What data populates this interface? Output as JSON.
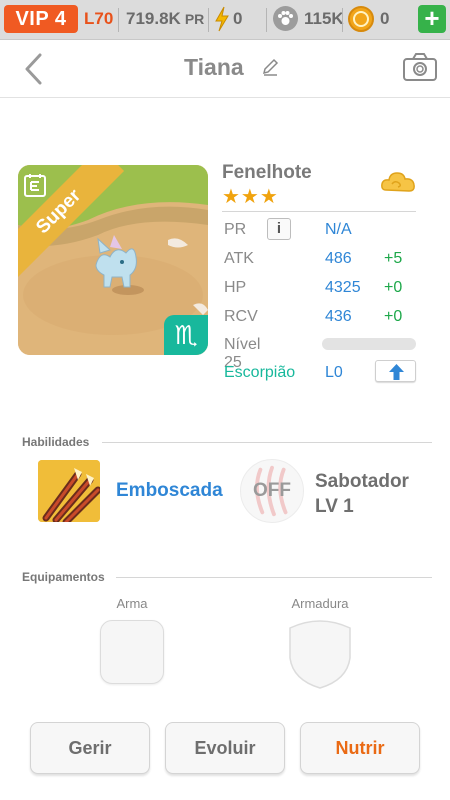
{
  "topbar": {
    "vip": "VIP 4",
    "level": "L70",
    "power": "719.8K",
    "power_unit": "PR",
    "energy": "0",
    "paw": "115K",
    "coins": "0",
    "add": "+"
  },
  "header": {
    "title": "Tiana"
  },
  "pet": {
    "badge": "Super",
    "name": "Fenelhote",
    "stars": "★★★",
    "zodiac_symbol": "♏",
    "stats": [
      {
        "label": "PR",
        "value": "N/A",
        "bonus": ""
      },
      {
        "label": "ATK",
        "value": "486",
        "bonus": "+5"
      },
      {
        "label": "HP",
        "value": "4325",
        "bonus": "+0"
      },
      {
        "label": "RCV",
        "value": "436",
        "bonus": "+0"
      }
    ],
    "info": "i",
    "level_label": "Nível 25",
    "level_progress": 0.0,
    "zodiac_name": "Escorpião",
    "zodiac_level": "L0"
  },
  "skills": {
    "title": "Habilidades",
    "active_name": "Emboscada",
    "passive_state": "OFF",
    "passive_name_line1": "Sabotador",
    "passive_name_line2": "LV 1"
  },
  "equipment": {
    "title": "Equipamentos",
    "weapon_label": "Arma",
    "armor_label": "Armadura"
  },
  "buttons": {
    "manage": "Gerir",
    "evolve": "Evoluir",
    "feed": "Nutrir"
  },
  "colors": {
    "vip": "#f05a22",
    "accent_blue": "#2f86d6",
    "accent_green": "#1ea84a",
    "zodiac_teal": "#18b89c",
    "orange": "#ea6a14"
  }
}
